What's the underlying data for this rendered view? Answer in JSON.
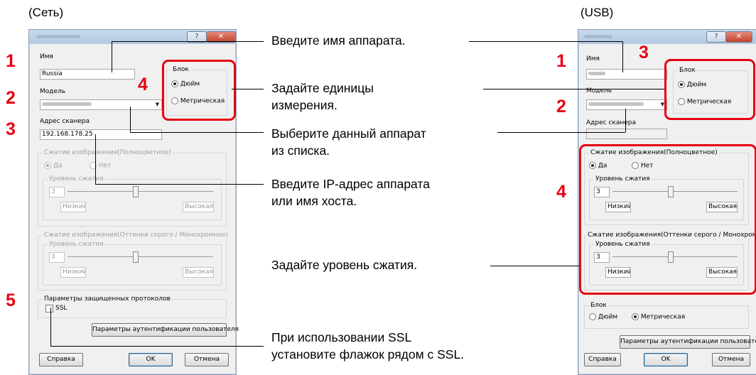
{
  "captions": {
    "net": "(Сеть)",
    "usb": "(USB)"
  },
  "numbers": {
    "n1": "1",
    "n2": "2",
    "n3": "3",
    "n4": "4",
    "n5": "5"
  },
  "net": {
    "name_label": "Имя",
    "name_value": "Russia",
    "model_label": "Модель",
    "scanner_label": "Адрес сканера",
    "scanner_value": "192.168.178.25",
    "unit_group": "Блок",
    "inch": "Дюйм",
    "metric": "Метрическая",
    "color_group": "Сжатие изображения(Полноцветное)",
    "yes": "Да",
    "no": "Нет",
    "level_group": "Уровень сжатия",
    "level_value": "3",
    "low": "Низкий",
    "high": "Высокая",
    "gray_group": "Сжатие изображения(Оттенки серого / Монохромное)",
    "secure_group": "Параметры защищенных протоколов",
    "ssl": "SSL",
    "auth_button": "Параметры аутентификации пользователя",
    "help_button": "Справка",
    "ok_button": "OK",
    "cancel_button": "Отмена"
  },
  "usb": {
    "name_label": "Имя",
    "model_label": "Модель",
    "scanner_label": "Адрес сканера",
    "unit_group": "Блок",
    "inch": "Дюйм",
    "metric": "Метрическая",
    "color_group": "Сжатие изображения(Полноцветное)",
    "yes": "Да",
    "no": "Нет",
    "level_group": "Уровень сжатия",
    "level_value": "3",
    "low": "Низкий",
    "high": "Высокая",
    "gray_group": "Сжатие изображения(Оттенки серого / Монохромное)",
    "unit_group2": "Блок",
    "inch2": "Дюйм",
    "metric2": "Метрическая",
    "auth_button": "Параметры аутентификации пользователя",
    "help_button": "Справка",
    "ok_button": "OK",
    "cancel_button": "Отмена"
  },
  "annotations": {
    "a1": "Введите имя аппарата.",
    "a2": "Задайте единицы\nизмерения.",
    "a3": "Выберите данный аппарат\nиз списка.",
    "a4": "Введите IP-адрес аппарата\nили имя хоста.",
    "a5": "Задайте уровень сжатия.",
    "a6": "При использовании SSL\nустановите флажок рядом с SSL."
  },
  "colors": {
    "accent": "#e60012",
    "dialog_bg": "#f0f0f0",
    "titlebar": "#b4c9e3"
  },
  "icons": {
    "help": "question-mark-icon",
    "close": "close-x-icon",
    "dropdown": "chevron-down-icon"
  }
}
